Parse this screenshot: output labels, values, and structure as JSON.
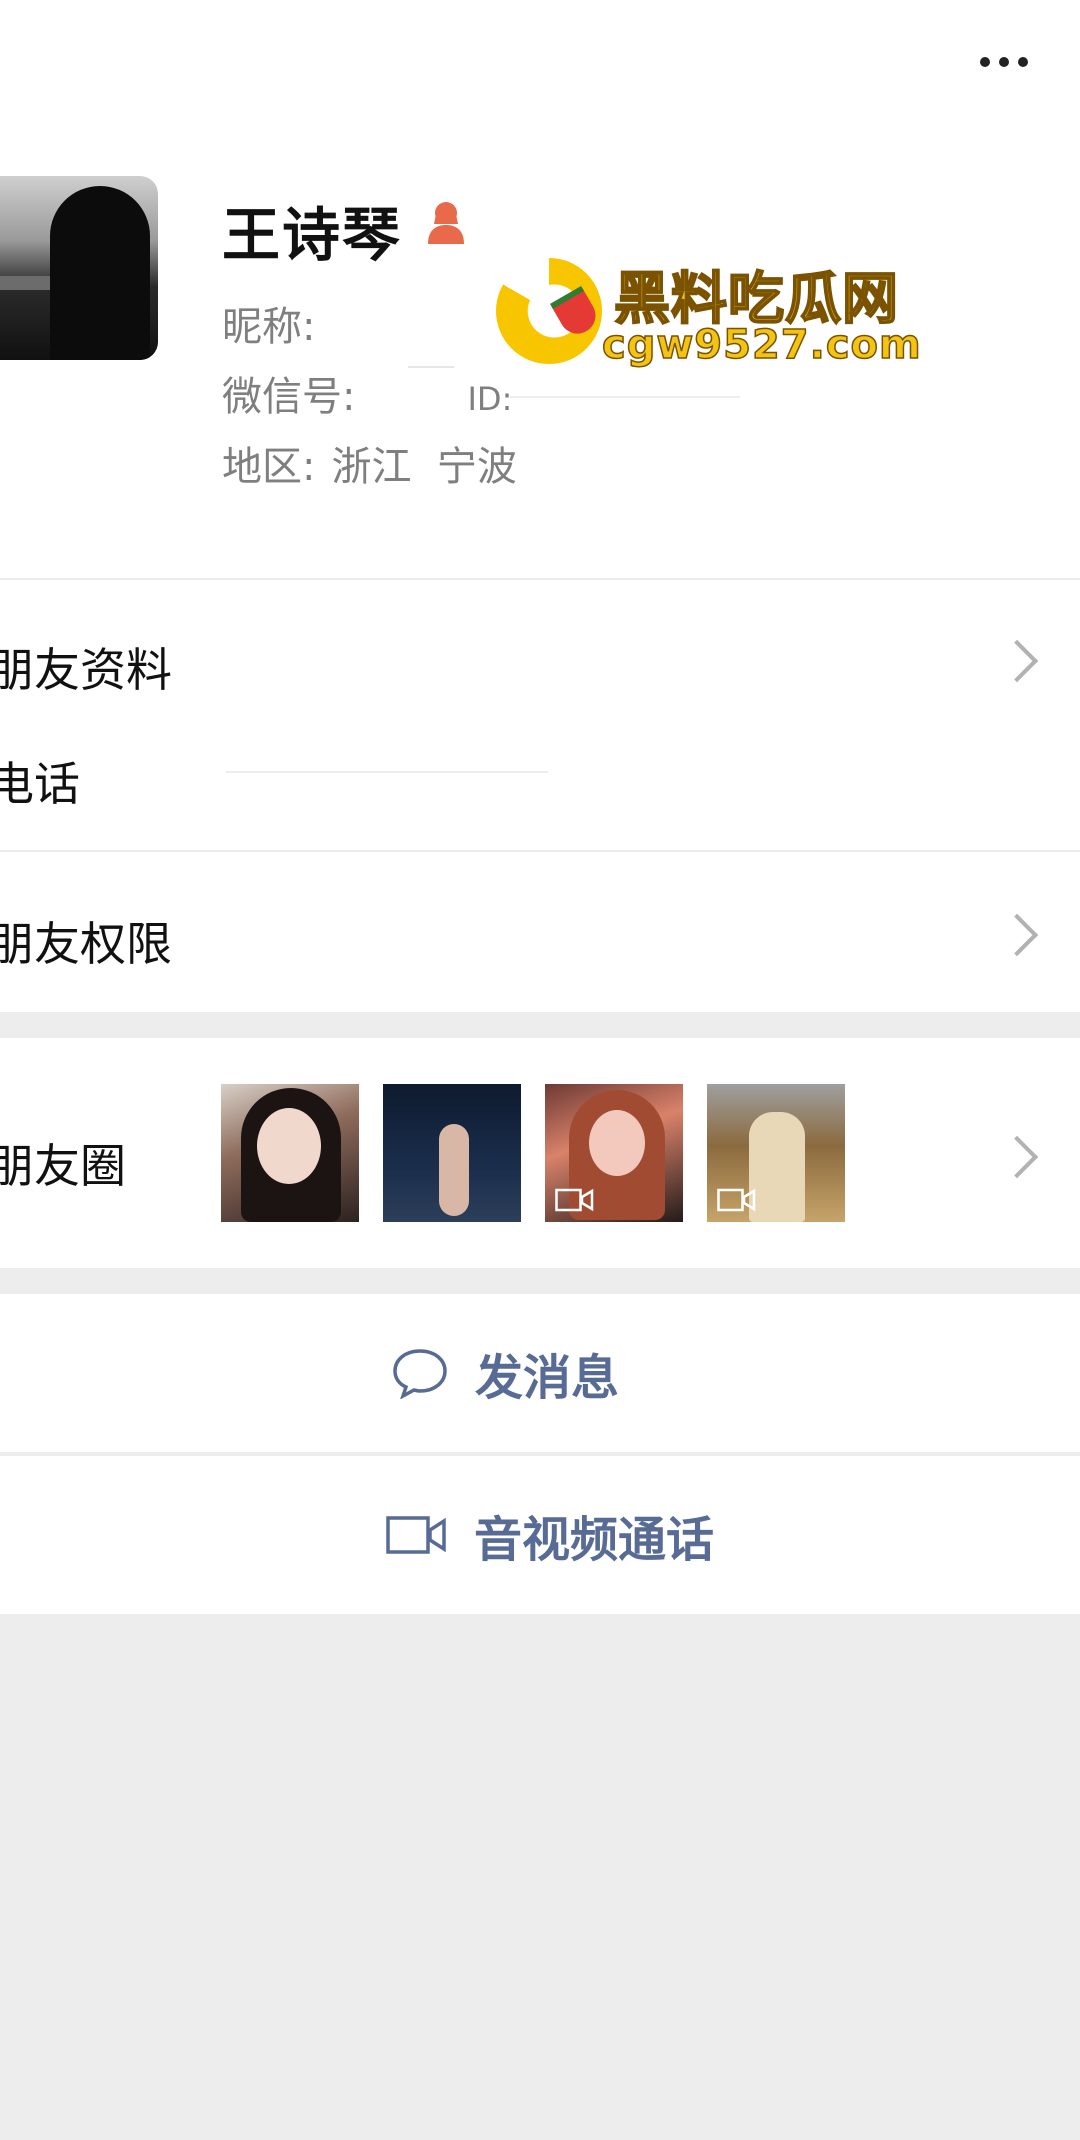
{
  "header": {
    "more_icon": "more-dots-icon"
  },
  "profile": {
    "name": "王诗琴",
    "gender_icon": "female-user-icon",
    "gender_color": "#e9694b",
    "nickname_label": "昵称:",
    "nickname_value": "",
    "wechat_label": "微信号:",
    "wechat_value": "",
    "wechat_fragment": "ID:",
    "region_label": "地区:",
    "region_value": "浙江  宁波"
  },
  "watermark": {
    "title": "黑料吃瓜网",
    "url": "cgw9527.com",
    "color": "#f3c413"
  },
  "sections": {
    "friend_info": "朋友资料",
    "phone": "电话",
    "phone_value": "",
    "friend_permissions": "朋友权限",
    "moments": "朋友圈"
  },
  "moments_thumbnails": [
    {
      "type": "photo"
    },
    {
      "type": "photo"
    },
    {
      "type": "video"
    },
    {
      "type": "video"
    }
  ],
  "actions": {
    "message": "发消息",
    "call": "音视频通话",
    "accent_color": "#576b95"
  }
}
